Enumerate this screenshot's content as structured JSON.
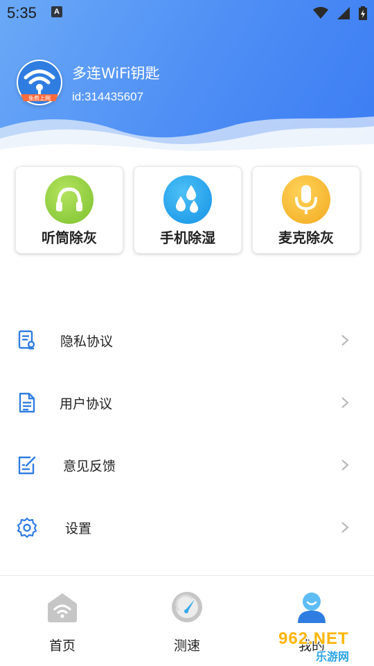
{
  "status_bar": {
    "time": "5:35",
    "notification_icon": "a-icon",
    "system_icons": [
      "wifi-icon",
      "signal-icon",
      "battery-icon"
    ]
  },
  "profile": {
    "app_name": "多连WiFi钥匙",
    "user_id": "id:314435607",
    "logo_icon": "wifi-key-logo",
    "logo_caption": "免费上网"
  },
  "tools": [
    {
      "label": "听筒除灰",
      "icon": "headphones-icon",
      "color": "#8bcf3a"
    },
    {
      "label": "手机除湿",
      "icon": "water-drops-icon",
      "color": "#1fa2ee"
    },
    {
      "label": "麦克除灰",
      "icon": "microphone-icon",
      "color": "#f5b72a"
    }
  ],
  "menu": [
    {
      "label": "隐私协议",
      "icon": "privacy-document-icon"
    },
    {
      "label": "用户协议",
      "icon": "user-agreement-icon"
    },
    {
      "label": "意见反馈",
      "icon": "feedback-edit-icon"
    },
    {
      "label": "设置",
      "icon": "gear-icon"
    }
  ],
  "bottom_nav": [
    {
      "label": "首页",
      "icon": "home-wifi-icon",
      "active": false
    },
    {
      "label": "测速",
      "icon": "speedometer-icon",
      "active": false
    },
    {
      "label": "我的",
      "icon": "user-profile-icon",
      "active": true
    }
  ],
  "watermark": {
    "top": "962.NET",
    "bottom": "乐游网"
  },
  "colors": {
    "header_blue": "#4d8df5",
    "accent_blue": "#2f7de1",
    "inactive_gray": "#bdbdbd"
  }
}
